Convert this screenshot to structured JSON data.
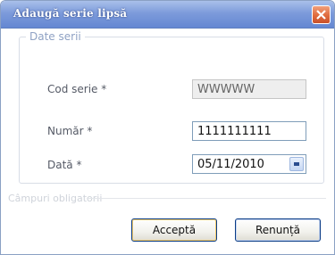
{
  "window": {
    "title": "Adaugă serie lipsă"
  },
  "group": {
    "title": "Date serii"
  },
  "fields": {
    "cod_serie": {
      "label": "Cod serie *",
      "value": "WWWWW"
    },
    "numar": {
      "label": "Număr *",
      "value": "1111111111"
    },
    "data": {
      "label": "Dată *",
      "value": "05/11/2010"
    }
  },
  "separator": {
    "label": "Câmpuri obligatorii"
  },
  "buttons": {
    "accept": "Acceptă",
    "cancel": "Renunță"
  },
  "icons": {
    "close": "close-icon",
    "calendar": "calendar-dropdown-icon"
  },
  "colors": {
    "titlebar": "#7d9bdb",
    "close": "#e06a3c",
    "group_title": "#8fa2c4"
  }
}
